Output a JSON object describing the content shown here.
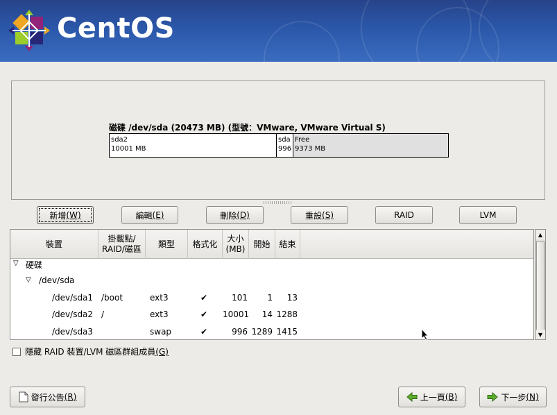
{
  "brand": {
    "name": "CentOS"
  },
  "disk": {
    "title": "磁碟 /dev/sda (20473 MB) (型號：VMware, VMware Virtual S)",
    "segments": [
      {
        "name": "sda2",
        "size": "10001 MB"
      },
      {
        "name": "sda",
        "size": "996"
      },
      {
        "name": "Free",
        "size": "9373 MB"
      }
    ]
  },
  "buttons": {
    "new": {
      "label": "新增",
      "key": "(W)"
    },
    "edit": {
      "label": "編輯",
      "key": "(E)"
    },
    "delete": {
      "label": "刪除",
      "key": "(D)"
    },
    "reset": {
      "label": "重設",
      "key": "(S)"
    },
    "raid": {
      "label": "RAID"
    },
    "lvm": {
      "label": "LVM"
    }
  },
  "table": {
    "headers": {
      "device": "裝置",
      "mount": "掛載點/\nRAID/磁區",
      "type": "類型",
      "format": "格式化",
      "size": "大小\n(MB)",
      "start": "開始",
      "end": "結束"
    },
    "tree": {
      "root": "硬碟",
      "disk": "/dev/sda"
    },
    "rows": [
      {
        "device": "/dev/sda1",
        "mount": "/boot",
        "type": "ext3",
        "format": "✔",
        "size": "101",
        "start": "1",
        "end": "13"
      },
      {
        "device": "/dev/sda2",
        "mount": "/",
        "type": "ext3",
        "format": "✔",
        "size": "10001",
        "start": "14",
        "end": "1288"
      },
      {
        "device": "/dev/sda3",
        "mount": "",
        "type": "swap",
        "format": "✔",
        "size": "996",
        "start": "1289",
        "end": "1415"
      }
    ]
  },
  "hide_option": {
    "label": "隱藏 RAID 裝置/LVM 磁區群組成員",
    "key": "(G)"
  },
  "footer": {
    "release_notes": {
      "label": "發行公告",
      "key": "(R)"
    },
    "back": {
      "label": "上一頁",
      "key": "(B)"
    },
    "next": {
      "label": "下一步",
      "key": "(N)"
    }
  }
}
